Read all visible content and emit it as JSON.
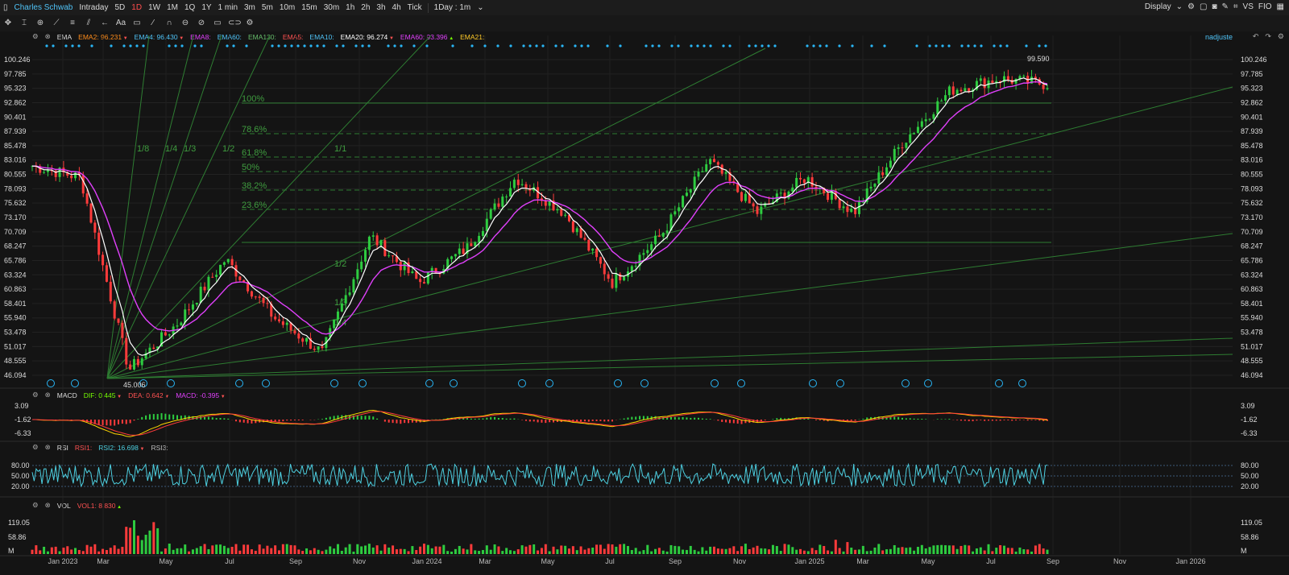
{
  "toolbar": {
    "symbol": "Charles Schwab",
    "periods": [
      "Intraday",
      "5D",
      "1D",
      "1W",
      "1M",
      "1Q",
      "1Y",
      "1 min",
      "3m",
      "5m",
      "10m",
      "15m",
      "30m",
      "1h",
      "2h",
      "3h",
      "4h",
      "Tick"
    ],
    "active_period": "1D",
    "interval": "1Day : 1m",
    "display_label": "Display",
    "vs_label": "VS",
    "fio_label": "FIO"
  },
  "adjust_label": "nadjuste",
  "indicators": {
    "ema": {
      "name": "EMA",
      "items": [
        {
          "label": "EMA2:",
          "value": "96.231",
          "color": "#ff8c1a",
          "arrow": "down"
        },
        {
          "label": "EMA4:",
          "value": "96.430",
          "color": "#4fc3f7",
          "arrow": "down"
        },
        {
          "label": "EMA8:",
          "value": "",
          "color": "#e040fb",
          "arrow": ""
        },
        {
          "label": "EMA60:",
          "value": "",
          "color": "#4fc3f7",
          "arrow": ""
        },
        {
          "label": "EMA130:",
          "value": "",
          "color": "#66bb6a",
          "arrow": ""
        },
        {
          "label": "EMA5:",
          "value": "",
          "color": "#ff5252",
          "arrow": ""
        },
        {
          "label": "EMA10:",
          "value": "",
          "color": "#4fc3f7",
          "arrow": ""
        },
        {
          "label": "EMA20:",
          "value": "96.274",
          "color": "#ffffff",
          "arrow": "down"
        },
        {
          "label": "EMA60:",
          "value": "93.396",
          "color": "#e040fb",
          "arrow": "up"
        },
        {
          "label": "EMA21:",
          "value": "",
          "color": "#ffca28",
          "arrow": ""
        }
      ]
    },
    "macd": {
      "name": "MACD",
      "items": [
        {
          "label": "DIF:",
          "value": "0.445",
          "color": "#76ff03",
          "arrow": "down"
        },
        {
          "label": "DEA:",
          "value": "0.642",
          "color": "#ff5252",
          "arrow": "down"
        },
        {
          "label": "MACD:",
          "value": "-0.395",
          "color": "#e040fb",
          "arrow": "down"
        }
      ]
    },
    "rsi": {
      "name": "RSI",
      "items": [
        {
          "label": "RSI1:",
          "value": "",
          "color": "#ff5252",
          "arrow": ""
        },
        {
          "label": "RSI2:",
          "value": "16.698",
          "color": "#4dd0e1",
          "arrow": "down"
        },
        {
          "label": "RSI3:",
          "value": "",
          "color": "#bdbdbd",
          "arrow": ""
        }
      ]
    },
    "vol": {
      "name": "VOL",
      "items": [
        {
          "label": "VOL1:",
          "value": "8.830",
          "color": "#ff5252",
          "arrow": "up"
        }
      ]
    }
  },
  "price_axis": [
    "100.246",
    "97.785",
    "95.323",
    "92.862",
    "90.401",
    "87.939",
    "85.478",
    "83.016",
    "80.555",
    "78.093",
    "75.632",
    "73.170",
    "70.709",
    "68.247",
    "65.786",
    "63.324",
    "60.863",
    "58.401",
    "55.940",
    "53.478",
    "51.017",
    "48.555",
    "46.094"
  ],
  "macd_axis": [
    "3.09",
    "-1.62",
    "-6.33"
  ],
  "rsi_axis": [
    "80.00",
    "50.00",
    "20.00"
  ],
  "vol_axis": [
    "119.05",
    "58.86",
    "M"
  ],
  "x_axis": [
    "Jan 2023",
    "Mar",
    "May",
    "Jul",
    "Sep",
    "Nov",
    "Jan 2024",
    "Mar",
    "May",
    "Jul",
    "Sep",
    "Nov",
    "Jan 2025",
    "Mar",
    "May",
    "Jul",
    "Sep",
    "Nov",
    "Jan 2026"
  ],
  "fib_labels": [
    "100%",
    "78.6%",
    "61.8%",
    "50%",
    "38.2%",
    "23.6%"
  ],
  "fan_labels": [
    "1/8",
    "1/4",
    "1/3",
    "1/2",
    "1/1",
    "1/2",
    "1/3",
    "1/4"
  ],
  "annotations": {
    "high": "99.590",
    "low": "45.006"
  },
  "chart_data": {
    "type": "line",
    "title": "",
    "x": [
      "Jan 2023",
      "Mar",
      "May",
      "Jul",
      "Sep",
      "Nov",
      "Jan 2024",
      "Mar",
      "May",
      "Jul",
      "Sep",
      "Nov",
      "Jan 2025",
      "Mar",
      "May",
      "Jul",
      "Sep"
    ],
    "series": [
      {
        "name": "",
        "values": [
          82,
          80,
          47,
          55,
          66,
          56,
          50,
          70,
          62,
          68,
          80,
          74,
          62,
          70,
          83,
          74,
          80,
          74,
          86,
          95,
          97,
          96
        ]
      }
    ],
    "ylim": [
      46.094,
      100.246
    ]
  }
}
